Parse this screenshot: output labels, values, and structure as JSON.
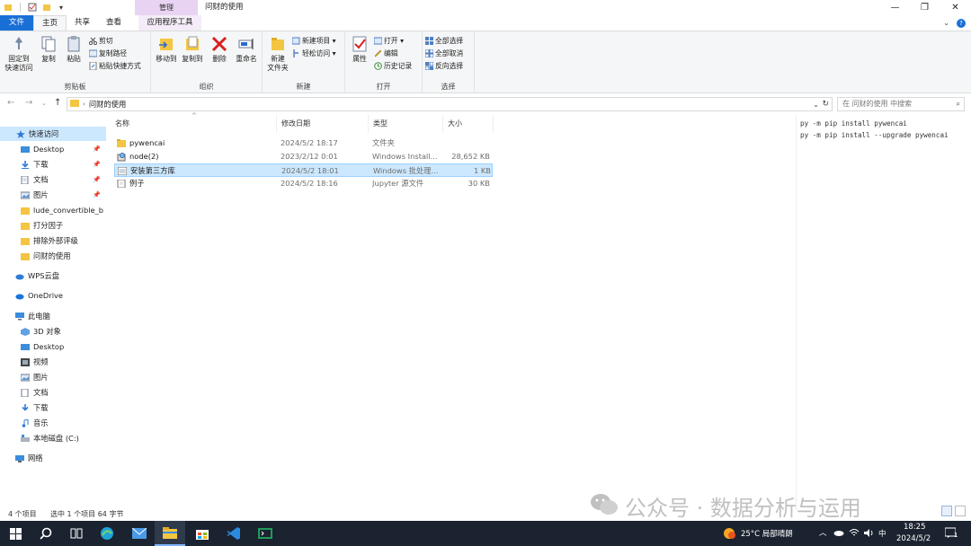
{
  "window": {
    "context_tab_label": "管理",
    "title": "问财的使用",
    "controls": {
      "minimize": "—",
      "maximize": "❐",
      "close": "✕"
    }
  },
  "ribbon_tabs": [
    {
      "label": "文件"
    },
    {
      "label": "主页"
    },
    {
      "label": "共享"
    },
    {
      "label": "查看"
    },
    {
      "label": "应用程序工具"
    }
  ],
  "ribbon": {
    "clipboard": {
      "label": "剪贴板",
      "pin_quick_access": "固定到\n快速访问",
      "pin_line1": "固定到",
      "pin_line2": "快速访问",
      "copy": "复制",
      "paste": "粘贴",
      "cut": "剪切",
      "copy_path": "复制路径",
      "paste_shortcut": "粘贴快捷方式"
    },
    "organize": {
      "label": "组织",
      "move_to": "移动到",
      "copy_to": "复制到",
      "delete": "删除",
      "rename": "重命名"
    },
    "new": {
      "label": "新建",
      "new_folder_line1": "新建",
      "new_folder_line2": "文件夹",
      "new_item": "新建项目 ▾",
      "easy_access": "轻松访问 ▾"
    },
    "open": {
      "label": "打开",
      "properties": "属性",
      "open": "打开 ▾",
      "edit": "编辑",
      "history": "历史记录"
    },
    "select": {
      "label": "选择",
      "select_all": "全部选择",
      "select_none": "全部取消",
      "invert": "反向选择"
    }
  },
  "address": {
    "path": "问财的使用",
    "search_placeholder": "在 问财的使用 中搜索"
  },
  "nav": {
    "quick_access": "快速访问",
    "items": [
      {
        "label": "Desktop",
        "pinned": true
      },
      {
        "label": "下载",
        "pinned": true
      },
      {
        "label": "文档",
        "pinned": true
      },
      {
        "label": "图片",
        "pinned": true
      },
      {
        "label": "lude_convertible_b",
        "pinned": false
      },
      {
        "label": "打分因子",
        "pinned": false
      },
      {
        "label": "排除外部评级",
        "pinned": false
      },
      {
        "label": "问财的使用",
        "pinned": false
      }
    ],
    "wps": "WPS云盘",
    "onedrive": "OneDrive",
    "this_pc": "此电脑",
    "pc_items": [
      {
        "label": "3D 对象"
      },
      {
        "label": "Desktop"
      },
      {
        "label": "视频"
      },
      {
        "label": "图片"
      },
      {
        "label": "文档"
      },
      {
        "label": "下载"
      },
      {
        "label": "音乐"
      },
      {
        "label": "本地磁盘 (C:)"
      }
    ],
    "network": "网络"
  },
  "columns": {
    "name": "名称",
    "modified": "修改日期",
    "type": "类型",
    "size": "大小"
  },
  "files": [
    {
      "name": "pywencai",
      "modified": "2024/5/2 18:17",
      "type": "文件夹",
      "size": ""
    },
    {
      "name": "node(2)",
      "modified": "2023/2/12 0:01",
      "type": "Windows Install...",
      "size": "28,652 KB"
    },
    {
      "name": "安装第三方库",
      "modified": "2024/5/2 18:01",
      "type": "Windows 批处理...",
      "size": "1 KB"
    },
    {
      "name": "例子",
      "modified": "2024/5/2 18:16",
      "type": "Jupyter 源文件",
      "size": "30 KB"
    }
  ],
  "notes": [
    "py -m pip install pywencai",
    "py -m pip install --upgrade pywencai"
  ],
  "status": {
    "count": "4 个项目",
    "selected": "选中 1 个项目  64 字节"
  },
  "watermark": "公众号 · 数据分析与运用",
  "taskbar": {
    "weather": "25°C  局部晴朗",
    "ime": "中",
    "time": "18:25",
    "date": "2024/5/2",
    "notification_count": "1"
  },
  "colors": {
    "accent": "#1a6fd6",
    "selection": "#cce8ff",
    "context_tab": "#e8d4f2",
    "taskbar": "#1b2330"
  }
}
